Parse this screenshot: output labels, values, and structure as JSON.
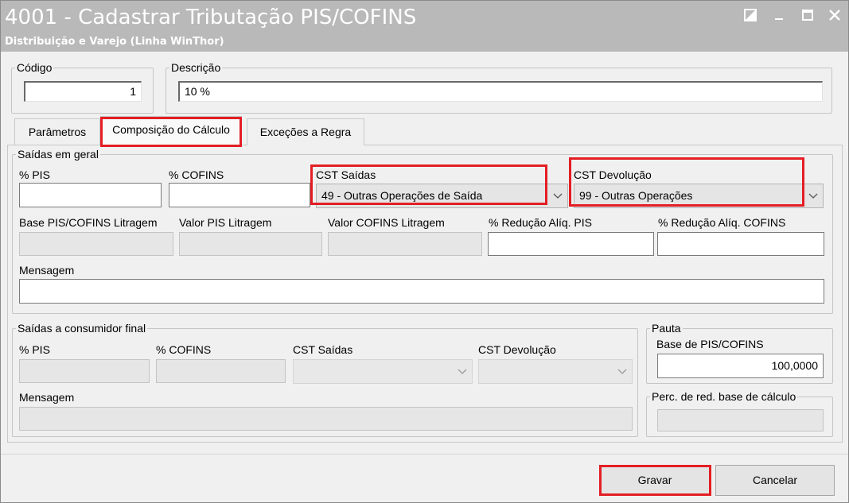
{
  "window": {
    "title": "4001 - Cadastrar Tributação PIS/COFINS",
    "subtitle": "Distribuição e Varejo (Linha WinThor)"
  },
  "header": {
    "codigo_label": "Código",
    "codigo_value": "1",
    "descricao_label": "Descrição",
    "descricao_value": "10 %"
  },
  "tabs": [
    {
      "label": "Parâmetros",
      "active": false
    },
    {
      "label": "Composição do Cálculo",
      "active": true
    },
    {
      "label": "Exceções a Regra",
      "active": false
    }
  ],
  "saidas_geral": {
    "legend": "Saídas em geral",
    "pis_label": "% PIS",
    "pis_value": "",
    "cofins_label": "% COFINS",
    "cofins_value": "",
    "cst_saidas_label": "CST Saídas",
    "cst_saidas_value": "49 - Outras Operações de Saída",
    "cst_devolucao_label": "CST Devolução",
    "cst_devolucao_value": "99 - Outras Operações",
    "base_litragem_label": "Base PIS/COFINS Litragem",
    "valor_pis_litragem_label": "Valor PIS Litragem",
    "valor_cofins_litragem_label": "Valor COFINS Litragem",
    "reducao_pis_label": "% Redução Alíq. PIS",
    "reducao_cofins_label": "% Redução Alíq. COFINS",
    "mensagem_label": "Mensagem",
    "mensagem_value": ""
  },
  "saidas_consumidor": {
    "legend": "Saídas a consumidor final",
    "pis_label": "% PIS",
    "cofins_label": "% COFINS",
    "cst_saidas_label": "CST Saídas",
    "cst_devolucao_label": "CST Devolução",
    "mensagem_label": "Mensagem"
  },
  "pauta": {
    "legend": "Pauta",
    "base_label": "Base de PIS/COFINS",
    "base_value": "100,0000"
  },
  "perc_red": {
    "legend": "Perc. de red. base de cálculo"
  },
  "buttons": {
    "gravar": "Gravar",
    "cancelar": "Cancelar"
  },
  "colors": {
    "highlight": "#e31e24",
    "titlebar": "#b9b9b9"
  }
}
